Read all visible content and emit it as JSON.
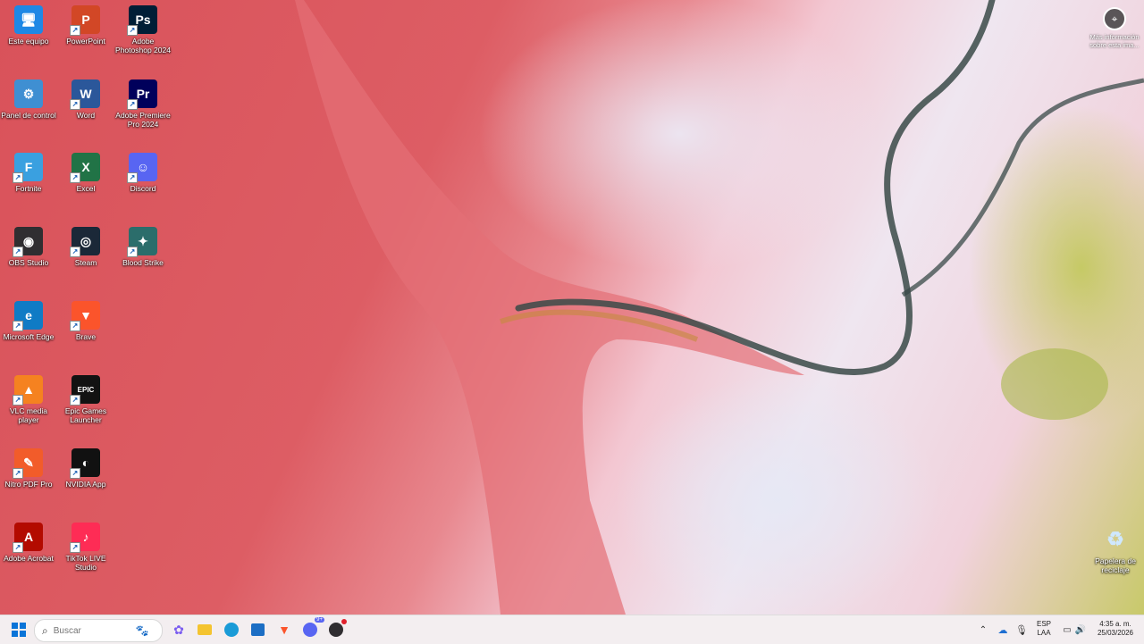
{
  "desktop": {
    "icons": [
      {
        "label": "Este equipo",
        "icon": "computer-icon",
        "color": "#1e88e5",
        "glyph": "🖥"
      },
      {
        "label": "PowerPoint",
        "icon": "powerpoint-icon",
        "color": "#d24726",
        "glyph": "P"
      },
      {
        "label": "Adobe Photoshop 2024",
        "icon": "photoshop-icon",
        "color": "#001e36",
        "glyph": "Ps"
      },
      {
        "label": "Panel de control",
        "icon": "control-panel-icon",
        "color": "#3f8fd2",
        "glyph": "⚙"
      },
      {
        "label": "Word",
        "icon": "word-icon",
        "color": "#2b579a",
        "glyph": "W"
      },
      {
        "label": "Adobe Premiere Pro 2024",
        "icon": "premiere-icon",
        "color": "#00005b",
        "glyph": "Pr"
      },
      {
        "label": "Fortnite",
        "icon": "fortnite-icon",
        "color": "#3aa0e0",
        "glyph": "F"
      },
      {
        "label": "Excel",
        "icon": "excel-icon",
        "color": "#217346",
        "glyph": "X"
      },
      {
        "label": "Discord",
        "icon": "discord-icon",
        "color": "#5865f2",
        "glyph": "☺"
      },
      {
        "label": "OBS Studio",
        "icon": "obs-icon",
        "color": "#302e31",
        "glyph": "◉"
      },
      {
        "label": "Steam",
        "icon": "steam-icon",
        "color": "#1b2838",
        "glyph": "◎"
      },
      {
        "label": "Blood Strike",
        "icon": "blood-strike-icon",
        "color": "#2b6d6b",
        "glyph": "✦"
      },
      {
        "label": "Microsoft Edge",
        "icon": "edge-icon",
        "color": "#0f7bc5",
        "glyph": "e"
      },
      {
        "label": "Brave",
        "icon": "brave-icon",
        "color": "#fb542b",
        "glyph": "▼"
      },
      {
        "label": "VLC media player",
        "icon": "vlc-icon",
        "color": "#f58220",
        "glyph": "▲"
      },
      {
        "label": "Epic Games Launcher",
        "icon": "epic-games-icon",
        "color": "#121212",
        "glyph": "EPIC"
      },
      {
        "label": "Nitro PDF Pro",
        "icon": "nitro-pdf-icon",
        "color": "#f25c2a",
        "glyph": "✎"
      },
      {
        "label": "NVIDIA App",
        "icon": "nvidia-icon",
        "color": "#111111",
        "glyph": "◐"
      },
      {
        "label": "Adobe Acrobat",
        "icon": "acrobat-icon",
        "color": "#b30b00",
        "glyph": "A"
      },
      {
        "label": "TikTok LIVE Studio",
        "icon": "tiktok-icon",
        "color": "#fe2c55",
        "glyph": "♪"
      }
    ],
    "recycle_bin": {
      "label": "Papelera de reciclaje",
      "icon": "recycle-bin-icon"
    },
    "spotlight": {
      "label": "Más información sobre esta ima...",
      "icon": "camera-info-icon"
    }
  },
  "taskbar": {
    "search": {
      "placeholder": "Buscar"
    },
    "language": {
      "line1": "ESP",
      "line2": "LAA"
    },
    "clock": {
      "time": "4:35 a. m.",
      "date": "25/03/2026"
    },
    "discord_badge": "9+"
  }
}
